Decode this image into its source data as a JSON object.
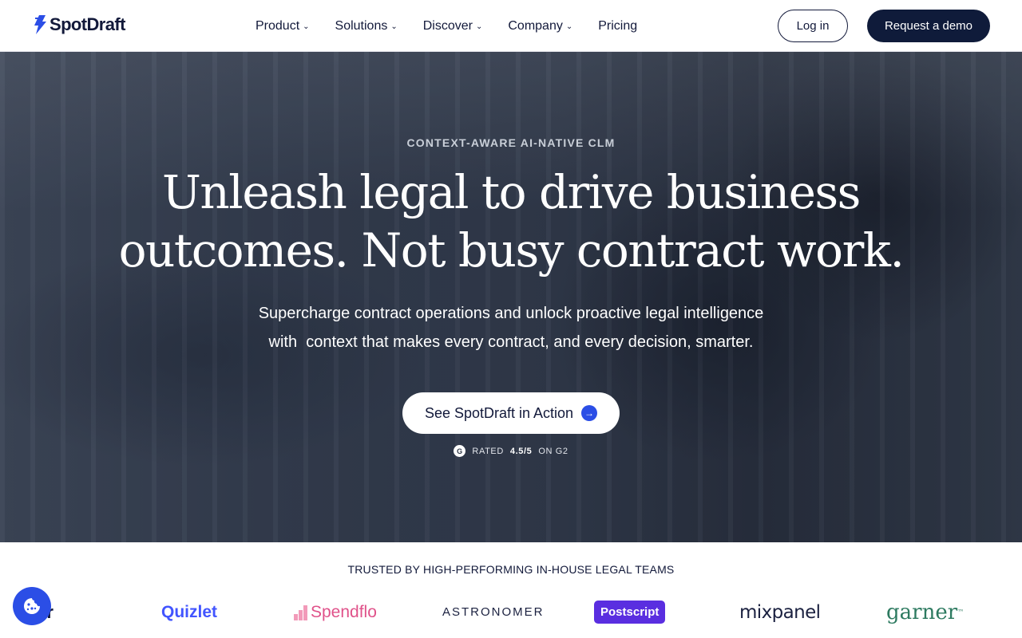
{
  "brand": {
    "name": "SpotDraft",
    "accent": "#2b4ee6",
    "navy": "#0f1b3a"
  },
  "nav": {
    "items": [
      {
        "label": "Product",
        "has_dropdown": true
      },
      {
        "label": "Solutions",
        "has_dropdown": true
      },
      {
        "label": "Discover",
        "has_dropdown": true
      },
      {
        "label": "Company",
        "has_dropdown": true
      },
      {
        "label": "Pricing",
        "has_dropdown": false
      }
    ],
    "login_label": "Log in",
    "demo_label": "Request a demo"
  },
  "hero": {
    "eyebrow": "CONTEXT-AWARE AI-NATIVE CLM",
    "headline_line1": "Unleash legal to drive business",
    "headline_line2": "outcomes. Not busy contract work.",
    "sub_line1": "Supercharge contract operations and unlock proactive legal intelligence",
    "sub_line2": "with  context that makes every contract, and every decision, smarter.",
    "cta_label": "See SpotDraft in Action",
    "rating_prefix": "RATED",
    "rating_value": "4.5/5",
    "rating_suffix": "ON G2"
  },
  "trusted": {
    "heading": "TRUSTED BY HIGH-PERFORMING IN-HOUSE LEGAL TEAMS",
    "logos": {
      "partial": "ler",
      "quizlet": "Quizlet",
      "spendflo": "Spendflo",
      "astronomer": "ASTRONOMER",
      "postscript": "Postscript",
      "mixpanel": "mixpanel",
      "garner": "garner"
    }
  },
  "icons": {
    "cookie": "cookie-icon",
    "cta_arrow": "arrow-right-icon",
    "g2": "g2-logo-icon",
    "chevron": "chevron-down-icon"
  }
}
